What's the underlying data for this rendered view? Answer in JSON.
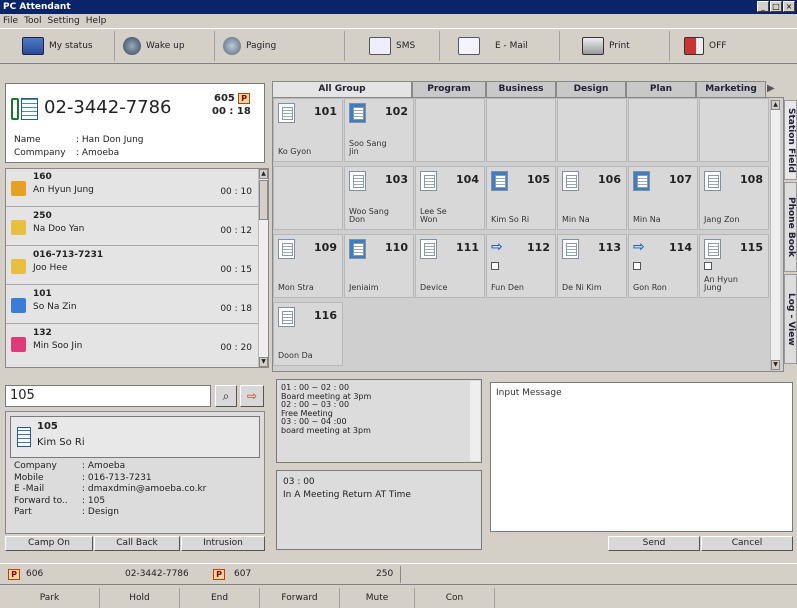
{
  "window": {
    "title": "PC Attendant",
    "min": "_",
    "max": "□",
    "close": "×"
  },
  "menu": [
    "File",
    "Tool",
    "Setting",
    "Help"
  ],
  "toolbar": {
    "my_status": "My status",
    "wake_up": "Wake up",
    "paging": "Paging",
    "sms": "SMS",
    "email": "E - Mail",
    "print": "Print",
    "off": "OFF"
  },
  "caller": {
    "number": "02-3442-7786",
    "ext": "605",
    "badge": "P",
    "time": "00 : 18",
    "name_label": "Name",
    "name": ": Han Don Jung",
    "company_label": "Commpany",
    "company": ": Amoeba"
  },
  "queue": [
    {
      "num": "160",
      "name": "An Hyun Jung",
      "time": "00 : 10",
      "color": "#e8a020"
    },
    {
      "num": "250",
      "name": "Na Doo Yan",
      "time": "00 : 12",
      "color": "#e8c040"
    },
    {
      "num": "016-713-7231",
      "name": "Joo Hee",
      "time": "00 : 15",
      "color": "#e8c040"
    },
    {
      "num": "101",
      "name": "So Na Zin",
      "time": "00 : 18",
      "color": "#3a7dd8"
    },
    {
      "num": "132",
      "name": "Min Soo Jin",
      "time": "00 : 20",
      "color": "#e03a7a"
    }
  ],
  "tabs": [
    "All Group",
    "Program",
    "Business",
    "Design",
    "Plan",
    "Marketing"
  ],
  "side_tabs": [
    "Station Field",
    "Phone Book",
    "Log - View"
  ],
  "stations": [
    {
      "num": "101",
      "name": "Ko Gyon",
      "type": "idle"
    },
    {
      "num": "102",
      "name": "Soo Sang Jin",
      "type": "busy"
    },
    {
      "num": "",
      "name": "",
      "type": "empty"
    },
    {
      "num": "",
      "name": "",
      "type": "empty"
    },
    {
      "num": "",
      "name": "",
      "type": "empty"
    },
    {
      "num": "",
      "name": "",
      "type": "empty"
    },
    {
      "num": "",
      "name": "",
      "type": "empty"
    },
    {
      "num": "",
      "name": "",
      "type": "empty"
    },
    {
      "num": "103",
      "name": "Woo Sang Don",
      "type": "idle"
    },
    {
      "num": "104",
      "name": "Lee Se Won",
      "type": "idle"
    },
    {
      "num": "105",
      "name": "Kim So Ri",
      "type": "busy"
    },
    {
      "num": "106",
      "name": "Min Na",
      "type": "idle"
    },
    {
      "num": "107",
      "name": "Min Na",
      "type": "busy"
    },
    {
      "num": "108",
      "name": "Jang Zon",
      "type": "idle"
    },
    {
      "num": "109",
      "name": "Mon Stra",
      "type": "idle"
    },
    {
      "num": "110",
      "name": "Jeniaim",
      "type": "busy"
    },
    {
      "num": "111",
      "name": "Device",
      "type": "idle"
    },
    {
      "num": "112",
      "name": "Fun Den",
      "type": "fwd"
    },
    {
      "num": "113",
      "name": "De Ni Kim",
      "type": "idle"
    },
    {
      "num": "114",
      "name": "Gon Ron",
      "type": "fwd"
    },
    {
      "num": "115",
      "name": "An Hyun Jung",
      "type": "dnd"
    },
    {
      "num": "116",
      "name": "Doon Da",
      "type": "idle"
    }
  ],
  "search": {
    "value": "105"
  },
  "detail": {
    "num": "105",
    "name": "Kim So Ri",
    "rows": [
      [
        "Company",
        ": Amoeba"
      ],
      [
        "Mobile",
        ": 016-713-7231"
      ],
      [
        "E -Mail",
        ": dmaxdmin@amoeba.co.kr"
      ],
      [
        "Forward to..",
        ": 105"
      ],
      [
        "Part",
        ": Design"
      ]
    ]
  },
  "detail_buttons": [
    "Camp On",
    "Call Back",
    "Intrusion"
  ],
  "schedule": "01 : 00 ~ 02 : 00\nBoard meeting at 3pm\n02 : 00 ~ 03 : 00\nFree Meeting\n03 : 00 ~ 04 :00\nboard meeting at 3pm",
  "note": {
    "time": "03 : 00",
    "text": "In A Meeting Return AT Time"
  },
  "message": {
    "label": "Input Message",
    "send": "Send",
    "cancel": "Cancel"
  },
  "status": {
    "badge1": "P",
    "ext1": "606",
    "num": "02-3442-7786",
    "badge2": "P",
    "ext2": "607",
    "ext3": "250"
  },
  "calls": [
    "Park",
    "Hold",
    "End",
    "Forward",
    "Mute",
    "Con"
  ]
}
